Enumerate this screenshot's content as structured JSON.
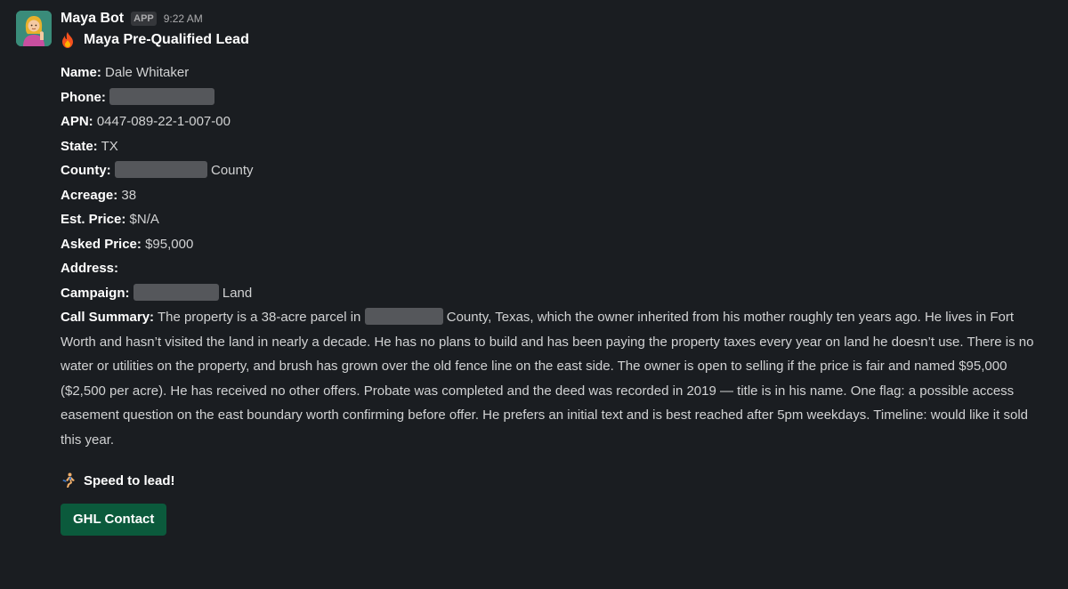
{
  "message": {
    "sender": "Maya Bot",
    "badge": "APP",
    "time": "9:22 AM",
    "title": "Maya Pre-Qualified Lead",
    "title_icon": "fire-icon",
    "fields": {
      "name_label": "Name:",
      "name_value": "Dale Whitaker",
      "phone_label": "Phone:",
      "apn_label": "APN:",
      "apn_value": "0447-089-22-1-007-00",
      "state_label": "State:",
      "state_value": "TX",
      "county_label": "County:",
      "county_suffix": "County",
      "acreage_label": "Acreage:",
      "acreage_value": "38",
      "est_price_label": "Est. Price:",
      "est_price_value": "$N/A",
      "asked_price_label": "Asked Price:",
      "asked_price_value": "$95,000",
      "address_label": "Address:",
      "campaign_label": "Campaign:",
      "campaign_suffix": "Land"
    },
    "summary": {
      "label": "Call Summary:",
      "before_redaction": "The property is a 38-acre parcel in",
      "after_redaction": "County, Texas, which the owner inherited from his mother roughly ten years ago. He lives in Fort Worth and hasn’t visited the land in nearly a decade. He has no plans to build and has been paying the property taxes every year on land he doesn’t use. There is no water or utilities on the property, and brush has grown over the old fence line on the east side. The owner is open to selling if the price is fair and named $95,000 ($2,500 per acre). He has received no other offers. Probate was completed and the deed was recorded in 2019 — title is in his name. One flag: a possible access easement question on the east boundary worth confirming before offer. He prefers an initial text and is best reached after 5pm weekdays. Timeline: would like it sold this year."
    },
    "speed_text": "Speed to lead!",
    "speed_icon": "runner-icon",
    "button_label": "GHL Contact"
  },
  "colors": {
    "background": "#1a1d21",
    "text": "#d1d2d3",
    "button": "#0b5a3c",
    "redaction": "#55575b"
  }
}
